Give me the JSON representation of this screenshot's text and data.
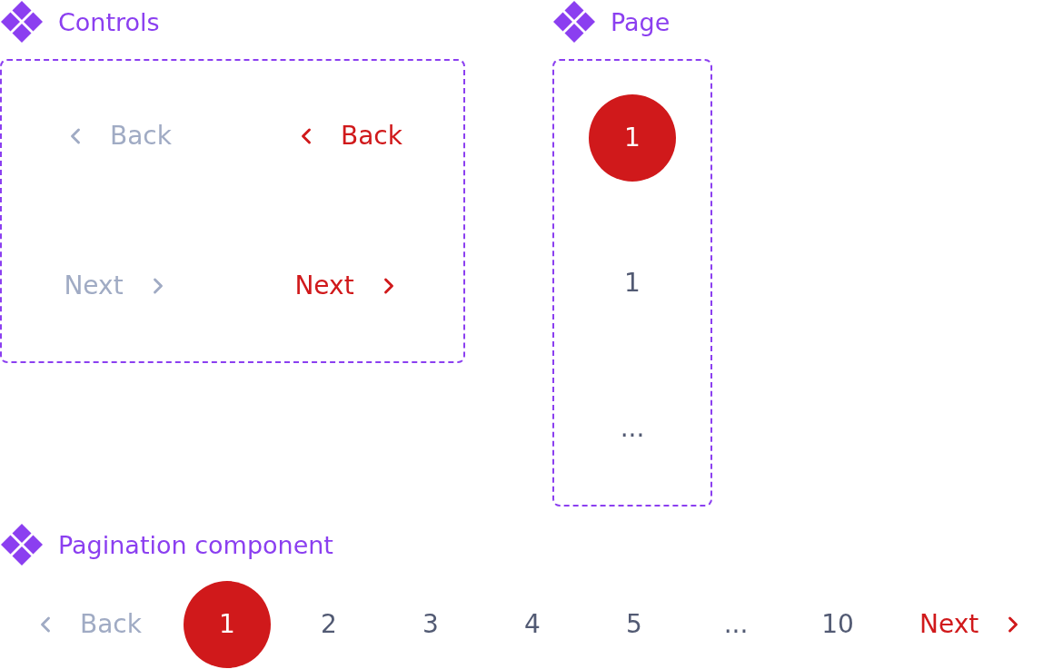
{
  "sections": [
    {
      "title": "Controls",
      "controls": [
        {
          "label": "Back",
          "kind": "back",
          "disabled": true
        },
        {
          "label": "Back",
          "kind": "back",
          "disabled": false
        },
        {
          "label": "Next",
          "kind": "next",
          "disabled": true
        },
        {
          "label": "Next",
          "kind": "next",
          "disabled": false
        }
      ]
    },
    {
      "title": "Page",
      "pages": [
        {
          "label": "1",
          "kind": "number",
          "selected": true
        },
        {
          "label": "1",
          "kind": "number",
          "selected": false
        },
        {
          "label": "...",
          "kind": "ellipsis"
        }
      ]
    }
  ],
  "pagination": {
    "title": "Pagination component",
    "back": {
      "label": "Back",
      "kind": "back",
      "disabled": true
    },
    "pages": [
      {
        "label": "1",
        "kind": "number",
        "selected": true
      },
      {
        "label": "2",
        "kind": "number",
        "selected": false
      },
      {
        "label": "3",
        "kind": "number",
        "selected": false
      },
      {
        "label": "4",
        "kind": "number",
        "selected": false
      },
      {
        "label": "5",
        "kind": "number",
        "selected": false
      },
      {
        "label": "...",
        "kind": "ellipsis"
      },
      {
        "label": "10",
        "kind": "number",
        "selected": false
      }
    ],
    "next": {
      "label": "Next",
      "kind": "next",
      "disabled": false
    }
  }
}
